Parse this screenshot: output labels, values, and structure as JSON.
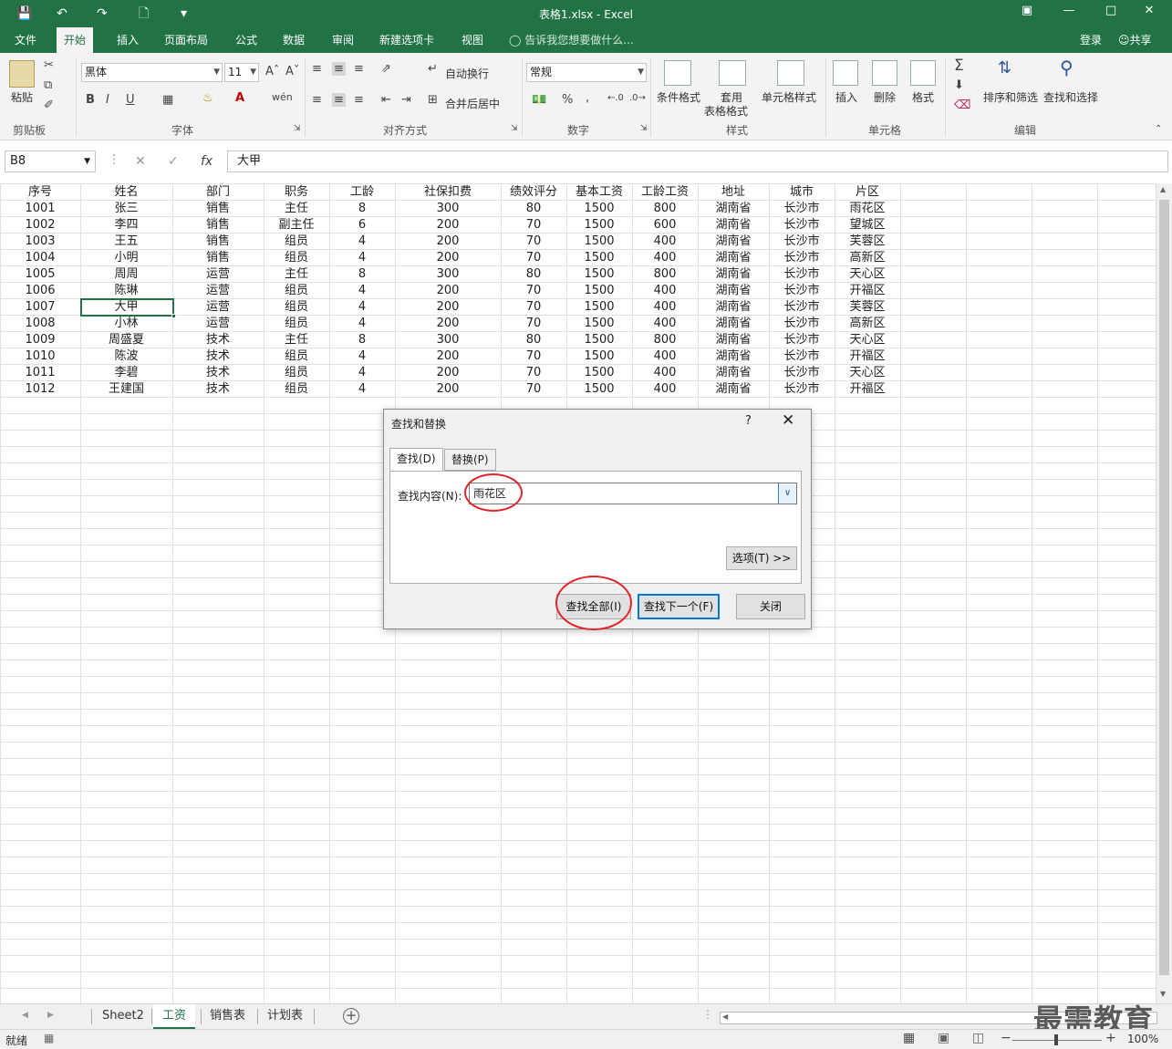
{
  "window": {
    "title": "表格1.xlsx - Excel"
  },
  "tabs": [
    "文件",
    "开始",
    "插入",
    "页面布局",
    "公式",
    "数据",
    "审阅",
    "新建选项卡",
    "视图"
  ],
  "active_tab": "开始",
  "tell_me": "告诉我您想要做什么...",
  "account": {
    "login": "登录",
    "share": "共享"
  },
  "ribbon": {
    "clipboard": {
      "paste": "粘贴",
      "group": "剪贴板"
    },
    "font": {
      "name": "黑体",
      "size": "11",
      "group": "字体"
    },
    "alignment": {
      "wrap": "自动换行",
      "merge": "合并后居中",
      "group": "对齐方式"
    },
    "number": {
      "format": "常规",
      "group": "数字",
      "percent": "%",
      "comma": ","
    },
    "styles": {
      "conditional": "条件格式",
      "table_line1": "套用",
      "table_line2": "表格格式",
      "cell_styles": "单元格样式",
      "group": "样式"
    },
    "cells": {
      "insert": "插入",
      "delete": "删除",
      "format": "格式",
      "group": "单元格"
    },
    "editing": {
      "sort": "排序和筛选",
      "find": "查找和选择",
      "group": "编辑"
    }
  },
  "formula_bar": {
    "name_box": "B8",
    "value": "大甲",
    "fx": "fx"
  },
  "sheet": {
    "headers": [
      "序号",
      "姓名",
      "部门",
      "职务",
      "工龄",
      "社保扣费",
      "绩效评分",
      "基本工资",
      "工龄工资",
      "地址",
      "城市",
      "片区"
    ],
    "rows": [
      [
        "1001",
        "张三",
        "销售",
        "主任",
        "8",
        "300",
        "80",
        "1500",
        "800",
        "湖南省",
        "长沙市",
        "雨花区"
      ],
      [
        "1002",
        "李四",
        "销售",
        "副主任",
        "6",
        "200",
        "70",
        "1500",
        "600",
        "湖南省",
        "长沙市",
        "望城区"
      ],
      [
        "1003",
        "王五",
        "销售",
        "组员",
        "4",
        "200",
        "70",
        "1500",
        "400",
        "湖南省",
        "长沙市",
        "芙蓉区"
      ],
      [
        "1004",
        "小明",
        "销售",
        "组员",
        "4",
        "200",
        "70",
        "1500",
        "400",
        "湖南省",
        "长沙市",
        "高新区"
      ],
      [
        "1005",
        "周周",
        "运营",
        "主任",
        "8",
        "300",
        "80",
        "1500",
        "800",
        "湖南省",
        "长沙市",
        "天心区"
      ],
      [
        "1006",
        "陈琳",
        "运营",
        "组员",
        "4",
        "200",
        "70",
        "1500",
        "400",
        "湖南省",
        "长沙市",
        "开福区"
      ],
      [
        "1007",
        "大甲",
        "运营",
        "组员",
        "4",
        "200",
        "70",
        "1500",
        "400",
        "湖南省",
        "长沙市",
        "芙蓉区"
      ],
      [
        "1008",
        "小林",
        "运营",
        "组员",
        "4",
        "200",
        "70",
        "1500",
        "400",
        "湖南省",
        "长沙市",
        "高新区"
      ],
      [
        "1009",
        "周盛夏",
        "技术",
        "主任",
        "8",
        "300",
        "80",
        "1500",
        "800",
        "湖南省",
        "长沙市",
        "天心区"
      ],
      [
        "1010",
        "陈波",
        "技术",
        "组员",
        "4",
        "200",
        "70",
        "1500",
        "400",
        "湖南省",
        "长沙市",
        "开福区"
      ],
      [
        "1011",
        "李碧",
        "技术",
        "组员",
        "4",
        "200",
        "70",
        "1500",
        "400",
        "湖南省",
        "长沙市",
        "天心区"
      ],
      [
        "1012",
        "王建国",
        "技术",
        "组员",
        "4",
        "200",
        "70",
        "1500",
        "400",
        "湖南省",
        "长沙市",
        "开福区"
      ]
    ]
  },
  "dialog": {
    "title": "查找和替换",
    "help": "?",
    "tabs": [
      "查找(D)",
      "替换(P)"
    ],
    "find_label": "查找内容(N):",
    "find_value": "雨花区",
    "options": "选项(T) >>",
    "find_all": "查找全部(I)",
    "find_next": "查找下一个(F)",
    "close": "关闭"
  },
  "sheet_tabs": [
    "Sheet2",
    "工资",
    "销售表",
    "计划表"
  ],
  "active_sheet": "工资",
  "status": {
    "ready": "就绪",
    "zoom": "100%"
  },
  "watermark": "最需教育",
  "colors": {
    "accent": "#217346",
    "highlight": "#e0262b",
    "dialog_focus": "#0078d7"
  }
}
